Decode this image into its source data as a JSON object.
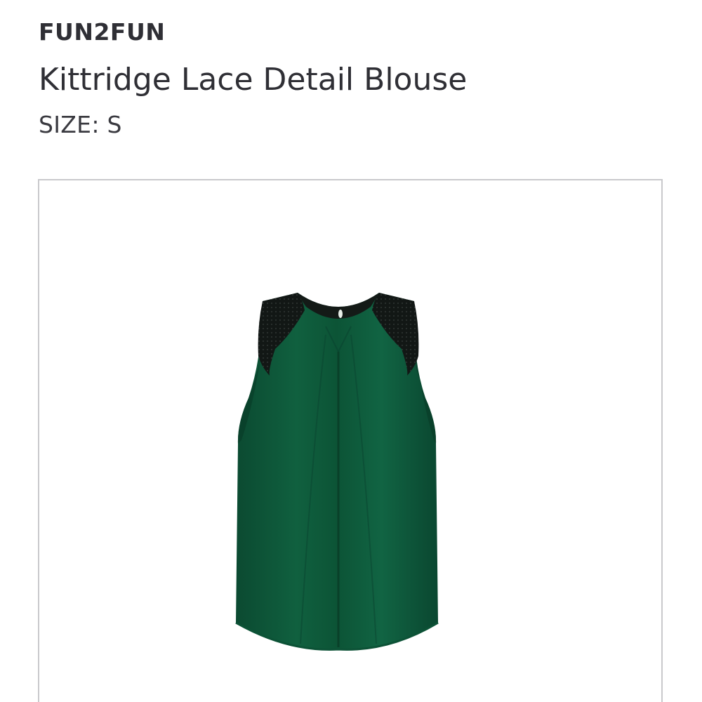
{
  "product": {
    "brand": "FUN2FUN",
    "title": "Kittridge Lace Detail Blouse",
    "size_label": "SIZE: S"
  },
  "image": {
    "subject": "blouse-icon",
    "fabric_color": "#0f5a3c",
    "lace_color": "#111614"
  }
}
